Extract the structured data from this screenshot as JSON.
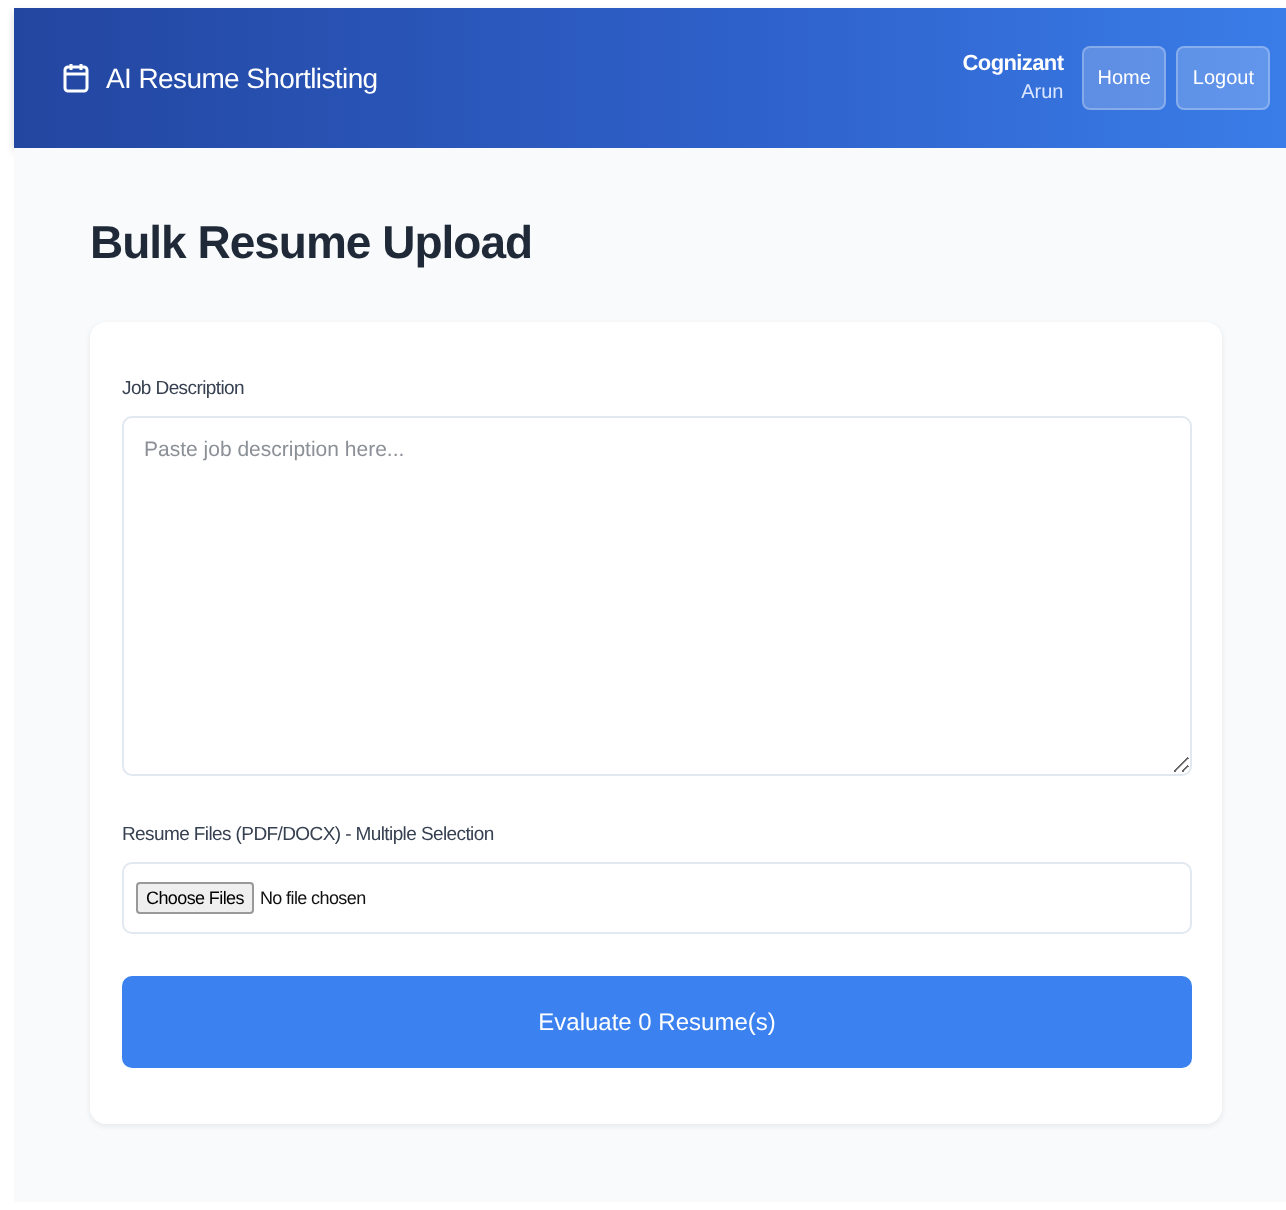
{
  "header": {
    "title": "AI Resume Shortlisting",
    "company": "Cognizant",
    "user": "Arun",
    "buttons": [
      "Home",
      "Logout"
    ]
  },
  "page_title": "Bulk Resume Upload",
  "form": {
    "job_description": {
      "label": "Job Description",
      "placeholder": "Paste job description here..."
    },
    "files": {
      "label": "Resume Files (PDF/DOCX) - Multiple Selection",
      "button": "Choose Files",
      "status": "No file chosen"
    },
    "submit": "Evaluate 0 Resume(s)"
  }
}
